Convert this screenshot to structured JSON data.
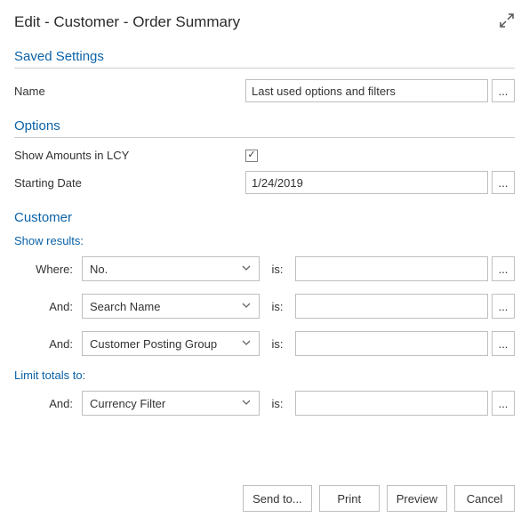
{
  "title": "Edit - Customer - Order Summary",
  "sections": {
    "saved": {
      "heading": "Saved Settings",
      "name_label": "Name",
      "name_value": "Last used options and filters"
    },
    "options": {
      "heading": "Options",
      "lcy_label": "Show Amounts in LCY",
      "lcy_checked": true,
      "date_label": "Starting Date",
      "date_value": "1/24/2019"
    },
    "customer": {
      "heading": "Customer",
      "show_results": "Show results:",
      "limit_totals": "Limit totals to:",
      "where": "Where:",
      "and": "And:",
      "is": "is:",
      "filters": [
        {
          "field": "No.",
          "value": ""
        },
        {
          "field": "Search Name",
          "value": ""
        },
        {
          "field": "Customer Posting Group",
          "value": ""
        }
      ],
      "limit": [
        {
          "field": "Currency Filter",
          "value": ""
        }
      ]
    }
  },
  "buttons": {
    "send": "Send to...",
    "print": "Print",
    "preview": "Preview",
    "cancel": "Cancel"
  },
  "ellipsis": "..."
}
